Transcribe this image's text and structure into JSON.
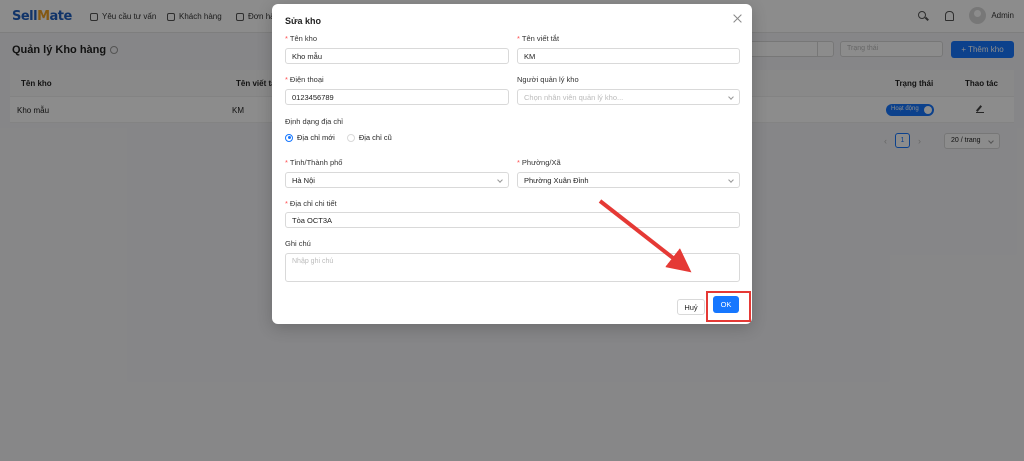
{
  "app": {
    "logo": {
      "part1": "Sell",
      "part2": "ate"
    },
    "nav": [
      {
        "label": "Yêu cầu tư vấn",
        "icon": "chat-icon"
      },
      {
        "label": "Khách hàng",
        "icon": "contact-card-icon"
      },
      {
        "label": "Đơn hà",
        "icon": "cart-icon"
      }
    ],
    "user": {
      "name": "Admin"
    }
  },
  "page": {
    "title": "Quản lý Kho hàng",
    "status_placeholder": "Trạng thái",
    "add_button": "+ Thêm kho",
    "table": {
      "columns": [
        "Tên kho",
        "Tên viết tắ",
        "Trạng thái",
        "Thao tác"
      ],
      "rows": [
        {
          "name": "Kho mẫu",
          "short": "KM",
          "status": "Hoạt động"
        }
      ]
    },
    "pagination": {
      "current": "1",
      "page_size": "20 / trang",
      "prev": "‹",
      "next": "›"
    }
  },
  "modal": {
    "title": "Sửa kho",
    "fields": {
      "name": {
        "label": "Tên kho",
        "value": "Kho mẫu"
      },
      "short": {
        "label": "Tên viết tắt",
        "value": "KM"
      },
      "phone": {
        "label": "Điện thoại",
        "value": "0123456789"
      },
      "manager": {
        "label": "Người quản lý kho",
        "placeholder": "Chọn nhân viên quản lý kho..."
      },
      "address_format": {
        "label": "Định dạng địa chỉ",
        "options": [
          "Địa chỉ mới",
          "Địa chỉ cũ"
        ],
        "selected": "Địa chỉ mới"
      },
      "province": {
        "label": "Tỉnh/Thành phố",
        "value": "Hà Nội"
      },
      "ward": {
        "label": "Phường/Xã",
        "value": "Phường Xuân Đỉnh"
      },
      "address": {
        "label": "Địa chỉ chi tiết",
        "value": "Tòa OCT3A"
      },
      "note": {
        "label": "Ghi chú",
        "placeholder": "Nhập ghi chú"
      }
    },
    "cancel_label": "Huỷ",
    "ok_label": "OK"
  },
  "annotation": {
    "arrow_color": "#e53935",
    "highlight_color": "#e53935"
  }
}
